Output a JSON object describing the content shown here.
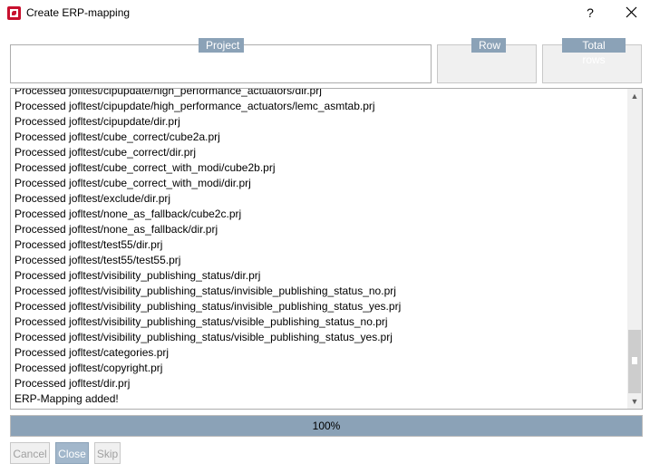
{
  "window": {
    "title": "Create ERP-mapping",
    "help_label": "?"
  },
  "groups": {
    "project_label": "Project",
    "row_label": "Row",
    "total_rows_label": "Total rows"
  },
  "log": {
    "lines": [
      "Processed jofltest/cipupdate/high_performance_actuators/dir.prj",
      "Processed jofltest/cipupdate/high_performance_actuators/lemc_asmtab.prj",
      "Processed jofltest/cipupdate/dir.prj",
      "Processed jofltest/cube_correct/cube2a.prj",
      "Processed jofltest/cube_correct/dir.prj",
      "Processed jofltest/cube_correct_with_modi/cube2b.prj",
      "Processed jofltest/cube_correct_with_modi/dir.prj",
      "Processed jofltest/exclude/dir.prj",
      "Processed jofltest/none_as_fallback/cube2c.prj",
      "Processed jofltest/none_as_fallback/dir.prj",
      "Processed jofltest/test55/dir.prj",
      "Processed jofltest/test55/test55.prj",
      "Processed jofltest/visibility_publishing_status/dir.prj",
      "Processed jofltest/visibility_publishing_status/invisible_publishing_status_no.prj",
      "Processed jofltest/visibility_publishing_status/invisible_publishing_status_yes.prj",
      "Processed jofltest/visibility_publishing_status/visible_publishing_status_no.prj",
      "Processed jofltest/visibility_publishing_status/visible_publishing_status_yes.prj",
      "Processed jofltest/categories.prj",
      "Processed jofltest/copyright.prj",
      "Processed jofltest/dir.prj",
      "ERP-Mapping added!"
    ]
  },
  "progress": {
    "value": 1.0,
    "label": "100%"
  },
  "buttons": {
    "cancel": "Cancel",
    "close": "Close",
    "skip": "Skip"
  },
  "colors": {
    "accent": "#8ba2b7",
    "app_icon": "#c8102e"
  }
}
